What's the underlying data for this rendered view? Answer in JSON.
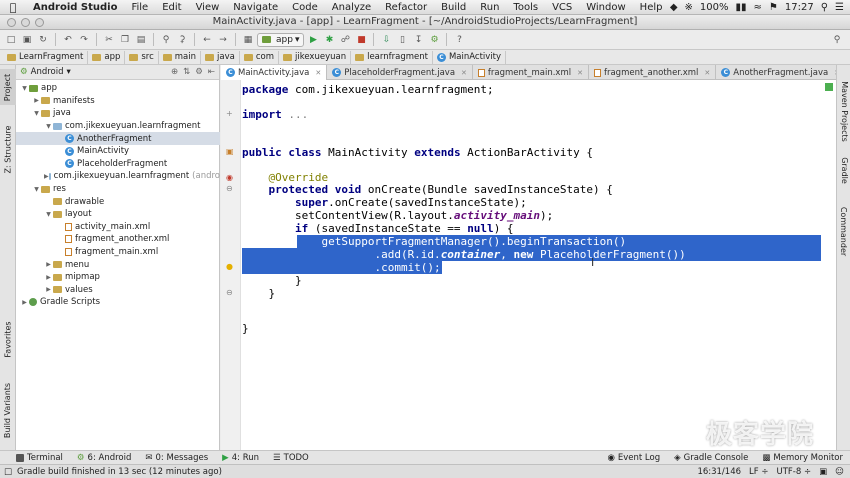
{
  "menubar": {
    "app_name": "Android Studio",
    "items": [
      "File",
      "Edit",
      "View",
      "Navigate",
      "Code",
      "Analyze",
      "Refactor",
      "Build",
      "Run",
      "Tools",
      "VCS",
      "Window",
      "Help"
    ],
    "battery": "100%",
    "clock": "17:27"
  },
  "window": {
    "title": "MainActivity.java - [app] - LearnFragment - [~/AndroidStudioProjects/LearnFragment]"
  },
  "toolbar": {
    "run_config": "app"
  },
  "breadcrumb": [
    "LearnFragment",
    "app",
    "src",
    "main",
    "java",
    "com",
    "jikexueyuan",
    "learnfragment",
    "MainActivity"
  ],
  "project_panel": {
    "view_mode": "Android",
    "tree": [
      {
        "label": "app",
        "level": 0,
        "expanded": true,
        "kind": "module"
      },
      {
        "label": "manifests",
        "level": 1,
        "expanded": false,
        "kind": "folder"
      },
      {
        "label": "java",
        "level": 1,
        "expanded": true,
        "kind": "folder"
      },
      {
        "label": "com.jikexueyuan.learnfragment",
        "level": 2,
        "expanded": true,
        "kind": "package"
      },
      {
        "label": "AnotherFragment",
        "level": 3,
        "kind": "class",
        "selected": true
      },
      {
        "label": "MainActivity",
        "level": 3,
        "kind": "class"
      },
      {
        "label": "PlaceholderFragment",
        "level": 3,
        "kind": "class"
      },
      {
        "label": "com.jikexueyuan.learnfragment",
        "suffix": "(andro",
        "level": 2,
        "expanded": false,
        "kind": "package"
      },
      {
        "label": "res",
        "level": 1,
        "expanded": true,
        "kind": "folder"
      },
      {
        "label": "drawable",
        "level": 2,
        "kind": "folder"
      },
      {
        "label": "layout",
        "level": 2,
        "expanded": true,
        "kind": "folder"
      },
      {
        "label": "activity_main.xml",
        "level": 3,
        "kind": "xml"
      },
      {
        "label": "fragment_another.xml",
        "level": 3,
        "kind": "xml"
      },
      {
        "label": "fragment_main.xml",
        "level": 3,
        "kind": "xml"
      },
      {
        "label": "menu",
        "level": 2,
        "expanded": false,
        "kind": "folder"
      },
      {
        "label": "mipmap",
        "level": 2,
        "expanded": false,
        "kind": "folder"
      },
      {
        "label": "values",
        "level": 2,
        "expanded": false,
        "kind": "folder"
      },
      {
        "label": "Gradle Scripts",
        "level": 0,
        "expanded": false,
        "kind": "gradle"
      }
    ]
  },
  "tabs": [
    {
      "label": "MainActivity.java",
      "kind": "class",
      "active": true
    },
    {
      "label": "PlaceholderFragment.java",
      "kind": "class"
    },
    {
      "label": "fragment_main.xml",
      "kind": "xml"
    },
    {
      "label": "fragment_another.xml",
      "kind": "xml"
    },
    {
      "label": "AnotherFragment.java",
      "kind": "class"
    }
  ],
  "left_tool_tabs": [
    "Project",
    "Z: Structure",
    "Favorites",
    "Build Variants"
  ],
  "right_tool_tabs": [
    "Maven Projects",
    "Gradle",
    "Commander"
  ],
  "bottom_tools": {
    "left": [
      "Terminal",
      "6: Android",
      "0: Messages",
      "4: Run",
      "TODO"
    ],
    "right": [
      "Event Log",
      "Gradle Console",
      "Memory Monitor"
    ]
  },
  "status": {
    "message": "Gradle build finished in 13 sec (12 minutes ago)",
    "position": "16:31/146",
    "line_sep": "LF ÷",
    "encoding": "UTF-8 ÷"
  },
  "watermark": "极客学院",
  "colors": {
    "selection": "#2f65ca",
    "keyword": "#000080",
    "annotation": "#808000",
    "field": "#660e7a"
  }
}
